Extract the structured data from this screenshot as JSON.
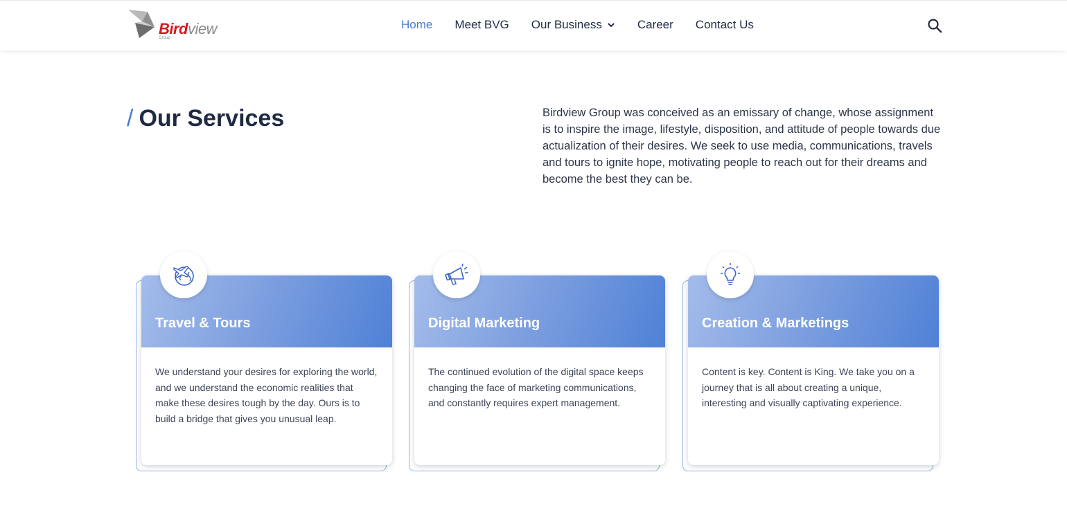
{
  "logo": {
    "text_red": "Bird",
    "text_gray": "view",
    "sub": "Group"
  },
  "nav": {
    "items": [
      {
        "label": "Home",
        "active": true
      },
      {
        "label": "Meet BVG"
      },
      {
        "label": "Our Business",
        "has_dropdown": true
      },
      {
        "label": "Career"
      },
      {
        "label": "Contact Us"
      }
    ],
    "search_icon": "search-icon"
  },
  "section": {
    "slash": "/",
    "title": "Our Services",
    "intro": "Birdview Group was conceived as an emissary of change, whose assignment is to inspire the image, lifestyle, disposition, and attitude of people towards due actualization of their desires. We seek to use media, communications, travels and tours to ignite hope, motivating people to reach out for their dreams and become the best they can be."
  },
  "cards": [
    {
      "icon": "globe-plane-icon",
      "title": "Travel & Tours",
      "text": "We understand your desires for exploring the world, and we understand the economic realities that make these desires tough by the day. Ours is to build a bridge that gives you unusual leap."
    },
    {
      "icon": "megaphone-icon",
      "title": "Digital Marketing",
      "text": "The continued evolution of the digital space keeps changing the face of marketing communications, and constantly requires expert management."
    },
    {
      "icon": "lightbulb-icon",
      "title": "Creation & Marketings",
      "text": "Content is key. Content is King. We take you on a journey that is all about creating a unique, interesting and visually captivating experience."
    }
  ],
  "colors": {
    "accent": "#4a7bd0",
    "heading": "#1f2a44",
    "logo_red": "#d71920",
    "card_gradient_start": "#a3bcea",
    "card_gradient_end": "#4f81d6"
  }
}
